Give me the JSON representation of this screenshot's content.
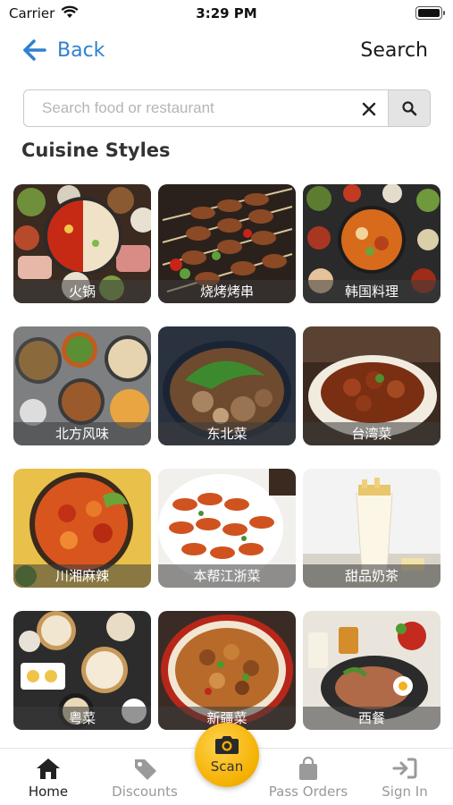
{
  "status_bar": {
    "carrier": "Carrier",
    "time": "3:29 PM"
  },
  "nav": {
    "back_label": "Back",
    "search_label": "Search"
  },
  "search": {
    "placeholder": "Search food or restaurant",
    "value": ""
  },
  "section_title": "Cuisine Styles",
  "cuisines": [
    {
      "label": "火锅"
    },
    {
      "label": "烧烤烤串"
    },
    {
      "label": "韩国料理"
    },
    {
      "label": "北方风味"
    },
    {
      "label": "东北菜"
    },
    {
      "label": "台湾菜"
    },
    {
      "label": "川湘麻辣"
    },
    {
      "label": "本帮江浙菜"
    },
    {
      "label": "甜品奶茶"
    },
    {
      "label": "粤菜"
    },
    {
      "label": "新疆菜"
    },
    {
      "label": "西餐"
    }
  ],
  "tabbar": {
    "home": "Home",
    "discounts": "Discounts",
    "scan": "Scan",
    "pass_orders": "Pass Orders",
    "sign_in": "Sign In"
  }
}
